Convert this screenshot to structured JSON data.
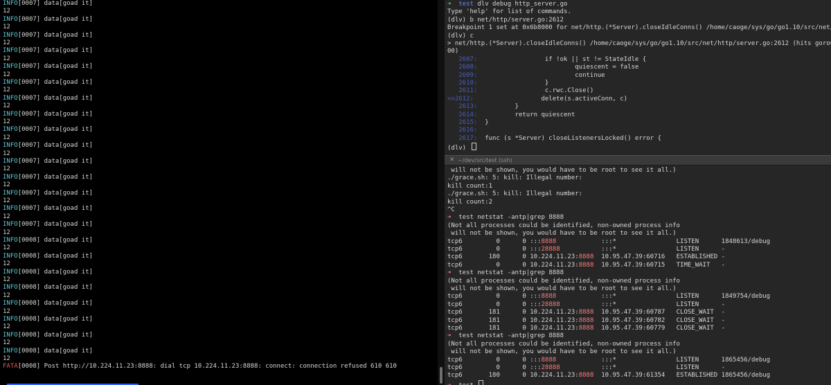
{
  "left_pane": {
    "lines": [
      {
        "pre": "INFO",
        "rest": "[0007] data[goad it]",
        "kind": "info"
      },
      {
        "pre": "",
        "rest": "12",
        "kind": "plain"
      },
      {
        "pre": "INFO",
        "rest": "[0007] data[goad it]",
        "kind": "info"
      },
      {
        "pre": "",
        "rest": "12",
        "kind": "plain"
      },
      {
        "pre": "INFO",
        "rest": "[0007] data[goad it]",
        "kind": "info"
      },
      {
        "pre": "",
        "rest": "12",
        "kind": "plain"
      },
      {
        "pre": "INFO",
        "rest": "[0007] data[goad it]",
        "kind": "info"
      },
      {
        "pre": "",
        "rest": "12",
        "kind": "plain"
      },
      {
        "pre": "INFO",
        "rest": "[0007] data[goad it]",
        "kind": "info"
      },
      {
        "pre": "",
        "rest": "12",
        "kind": "plain"
      },
      {
        "pre": "INFO",
        "rest": "[0007] data[goad it]",
        "kind": "info"
      },
      {
        "pre": "",
        "rest": "12",
        "kind": "plain"
      },
      {
        "pre": "INFO",
        "rest": "[0007] data[goad it]",
        "kind": "info"
      },
      {
        "pre": "",
        "rest": "12",
        "kind": "plain"
      },
      {
        "pre": "INFO",
        "rest": "[0007] data[goad it]",
        "kind": "info"
      },
      {
        "pre": "",
        "rest": "12",
        "kind": "plain"
      },
      {
        "pre": "INFO",
        "rest": "[0007] data[goad it]",
        "kind": "info"
      },
      {
        "pre": "",
        "rest": "12",
        "kind": "plain"
      },
      {
        "pre": "INFO",
        "rest": "[0007] data[goad it]",
        "kind": "info"
      },
      {
        "pre": "",
        "rest": "12",
        "kind": "plain"
      },
      {
        "pre": "INFO",
        "rest": "[0007] data[goad it]",
        "kind": "info"
      },
      {
        "pre": "",
        "rest": "12",
        "kind": "plain"
      },
      {
        "pre": "INFO",
        "rest": "[0007] data[goad it]",
        "kind": "info"
      },
      {
        "pre": "",
        "rest": "12",
        "kind": "plain"
      },
      {
        "pre": "INFO",
        "rest": "[0007] data[goad it]",
        "kind": "info"
      },
      {
        "pre": "",
        "rest": "12",
        "kind": "plain"
      },
      {
        "pre": "INFO",
        "rest": "[0007] data[goad it]",
        "kind": "info"
      },
      {
        "pre": "",
        "rest": "12",
        "kind": "plain"
      },
      {
        "pre": "INFO",
        "rest": "[0007] data[goad it]",
        "kind": "info"
      },
      {
        "pre": "",
        "rest": "12",
        "kind": "plain"
      },
      {
        "pre": "INFO",
        "rest": "[0008] data[goad it]",
        "kind": "info"
      },
      {
        "pre": "",
        "rest": "12",
        "kind": "plain"
      },
      {
        "pre": "INFO",
        "rest": "[0008] data[goad it]",
        "kind": "info"
      },
      {
        "pre": "",
        "rest": "12",
        "kind": "plain"
      },
      {
        "pre": "INFO",
        "rest": "[0008] data[goad it]",
        "kind": "info"
      },
      {
        "pre": "",
        "rest": "12",
        "kind": "plain"
      },
      {
        "pre": "INFO",
        "rest": "[0008] data[goad it]",
        "kind": "info"
      },
      {
        "pre": "",
        "rest": "12",
        "kind": "plain"
      },
      {
        "pre": "INFO",
        "rest": "[0008] data[goad it]",
        "kind": "info"
      },
      {
        "pre": "",
        "rest": "12",
        "kind": "plain"
      },
      {
        "pre": "INFO",
        "rest": "[0008] data[goad it]",
        "kind": "info"
      },
      {
        "pre": "",
        "rest": "12",
        "kind": "plain"
      },
      {
        "pre": "INFO",
        "rest": "[0008] data[goad it]",
        "kind": "info"
      },
      {
        "pre": "",
        "rest": "12",
        "kind": "plain"
      },
      {
        "pre": "INFO",
        "rest": "[0008] data[goad it]",
        "kind": "info"
      },
      {
        "pre": "",
        "rest": "12",
        "kind": "plain"
      },
      {
        "pre": "FATA",
        "rest": "[0008] Post http://10.224.11.23:8888: dial tcp 10.224.11.23:8888: connect: connection refused 610 610",
        "kind": "fatal"
      }
    ]
  },
  "right_top": {
    "lines": [
      {
        "kind": "prompt",
        "arrow": "➜",
        "dir": "test",
        "cmd": " dlv debug http_server.go"
      },
      {
        "kind": "text",
        "text": "Type 'help' for list of commands."
      },
      {
        "kind": "text",
        "text": "(dlv) b net/http/server.go:2612"
      },
      {
        "kind": "text",
        "text": "Breakpoint 1 set at 0x6b8000 for net/http.(*Server).closeIdleConns() /home/caoge/sys/go/go1.10/src/net/http/server.go:2"
      },
      {
        "kind": "text",
        "text": "(dlv) c"
      },
      {
        "kind": "text",
        "text": "> net/http.(*Server).closeIdleConns() /home/caoge/sys/go/go1.10/src/net/http/server.go:2612 (hits goroutine(6):1 total:"
      },
      {
        "kind": "text",
        "text": "00)"
      },
      {
        "kind": "code",
        "gutter": "   2607:",
        "code": "                  if !ok || st != StateIdle {"
      },
      {
        "kind": "code",
        "gutter": "   2608:",
        "code": "                          quiescent = false"
      },
      {
        "kind": "code",
        "gutter": "   2609:",
        "code": "                          continue"
      },
      {
        "kind": "code",
        "gutter": "   2610:",
        "code": "                  }"
      },
      {
        "kind": "code",
        "gutter": "   2611:",
        "code": "                  c.rwc.Close()"
      },
      {
        "kind": "code",
        "gutter": "=>2612:",
        "code": "                  delete(s.activeConn, c)"
      },
      {
        "kind": "code",
        "gutter": "   2613:",
        "code": "          }"
      },
      {
        "kind": "code",
        "gutter": "   2614:",
        "code": "          return quiescent"
      },
      {
        "kind": "code",
        "gutter": "   2615:",
        "code": "  }"
      },
      {
        "kind": "code",
        "gutter": "   2616:",
        "code": ""
      },
      {
        "kind": "code",
        "gutter": "   2617:",
        "code": "  func (s *Server) closeListenersLocked() error {"
      },
      {
        "kind": "cursor",
        "text": "(dlv) "
      }
    ]
  },
  "tab": {
    "close_glyph": "✕",
    "title": "~/dev/src/test (ssh)"
  },
  "right_bottom": {
    "lines": [
      {
        "kind": "text",
        "text": " will not be shown, you would have to be root to see it all.)"
      },
      {
        "kind": "text",
        "text": "./grace.sh: 5: kill: Illegal number:"
      },
      {
        "kind": "text",
        "text": "kill count:1"
      },
      {
        "kind": "text",
        "text": "./grace.sh: 5: kill: Illegal number:"
      },
      {
        "kind": "text",
        "text": "kill count:2"
      },
      {
        "kind": "text",
        "text": "^C"
      },
      {
        "kind": "prompt",
        "arrow": "➜",
        "dir": "test",
        "cmd": " netstat -antp|grep 8888"
      },
      {
        "kind": "text",
        "text": "(Not all processes could be identified, non-owned process info"
      },
      {
        "kind": "text",
        "text": " will not be shown, you would have to be root to see it all.)"
      },
      {
        "kind": "net",
        "proto": "tcp6",
        "rq": "0",
        "sq": "0",
        "lhost": ":::",
        "lport": "8888",
        "lpad": "            ",
        "remote": ":::*",
        "state": "LISTEN",
        "pid": "1848613/debug"
      },
      {
        "kind": "net",
        "proto": "tcp6",
        "rq": "0",
        "sq": "0",
        "lhost": ":::",
        "lport": "28888",
        "lpad": "           ",
        "remote": ":::*",
        "state": "LISTEN",
        "pid": "-"
      },
      {
        "kind": "net",
        "proto": "tcp6",
        "rq": "180",
        "sq": "0",
        "lhost": "10.224.11.23:",
        "lport": "8888",
        "lpad": "  ",
        "remote": "10.95.47.39:60716",
        "state": "ESTABLISHED",
        "pid": "-"
      },
      {
        "kind": "net",
        "proto": "tcp6",
        "rq": "0",
        "sq": "0",
        "lhost": "10.224.11.23:",
        "lport": "8888",
        "lpad": "  ",
        "remote": "10.95.47.39:60715",
        "state": "TIME_WAIT",
        "pid": "-"
      },
      {
        "kind": "prompt",
        "arrow": "➜",
        "dir": "test",
        "cmd": " netstat -antp|grep 8888"
      },
      {
        "kind": "text",
        "text": "(Not all processes could be identified, non-owned process info"
      },
      {
        "kind": "text",
        "text": " will not be shown, you would have to be root to see it all.)"
      },
      {
        "kind": "net",
        "proto": "tcp6",
        "rq": "0",
        "sq": "0",
        "lhost": ":::",
        "lport": "8888",
        "lpad": "            ",
        "remote": ":::*",
        "state": "LISTEN",
        "pid": "1849754/debug"
      },
      {
        "kind": "net",
        "proto": "tcp6",
        "rq": "0",
        "sq": "0",
        "lhost": ":::",
        "lport": "28888",
        "lpad": "           ",
        "remote": ":::*",
        "state": "LISTEN",
        "pid": "-"
      },
      {
        "kind": "net",
        "proto": "tcp6",
        "rq": "181",
        "sq": "0",
        "lhost": "10.224.11.23:",
        "lport": "8888",
        "lpad": "  ",
        "remote": "10.95.47.39:60787",
        "state": "CLOSE_WAIT",
        "pid": "-"
      },
      {
        "kind": "net",
        "proto": "tcp6",
        "rq": "181",
        "sq": "0",
        "lhost": "10.224.11.23:",
        "lport": "8888",
        "lpad": "  ",
        "remote": "10.95.47.39:60782",
        "state": "CLOSE_WAIT",
        "pid": "-"
      },
      {
        "kind": "net",
        "proto": "tcp6",
        "rq": "181",
        "sq": "0",
        "lhost": "10.224.11.23:",
        "lport": "8888",
        "lpad": "  ",
        "remote": "10.95.47.39:60779",
        "state": "CLOSE_WAIT",
        "pid": "-"
      },
      {
        "kind": "prompt",
        "arrow": "➜",
        "dir": "test",
        "cmd": " netstat -antp|grep 8888"
      },
      {
        "kind": "text",
        "text": "(Not all processes could be identified, non-owned process info"
      },
      {
        "kind": "text",
        "text": " will not be shown, you would have to be root to see it all.)"
      },
      {
        "kind": "net",
        "proto": "tcp6",
        "rq": "0",
        "sq": "0",
        "lhost": ":::",
        "lport": "8888",
        "lpad": "            ",
        "remote": ":::*",
        "state": "LISTEN",
        "pid": "1865456/debug"
      },
      {
        "kind": "net",
        "proto": "tcp6",
        "rq": "0",
        "sq": "0",
        "lhost": ":::",
        "lport": "28888",
        "lpad": "           ",
        "remote": ":::*",
        "state": "LISTEN",
        "pid": "-"
      },
      {
        "kind": "net",
        "proto": "tcp6",
        "rq": "180",
        "sq": "0",
        "lhost": "10.224.11.23:",
        "lport": "8888",
        "lpad": "  ",
        "remote": "10.95.47.39:61354",
        "state": "ESTABLISHED",
        "pid": "1865456/debug"
      },
      {
        "kind": "promptcur",
        "arrow": "➜",
        "dir": "test",
        "cmd": " "
      }
    ]
  },
  "colors": {
    "terminal_bg": "#000000",
    "pane_bg": "#262626",
    "info": "#5fc9d8",
    "fatal": "#e05757",
    "prompt_arrow": "#5fd35f",
    "prompt_dir": "#6a86ff",
    "port_highlight": "#ff7a7a"
  }
}
